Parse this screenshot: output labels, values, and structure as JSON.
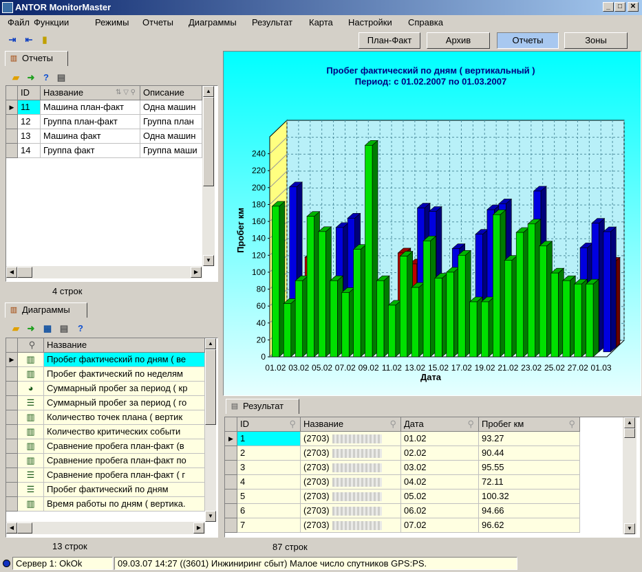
{
  "window": {
    "title": "ANTOR MonitorMaster"
  },
  "menu": [
    "Файл",
    "Функции",
    "Режимы",
    "Отчеты",
    "Диаграммы",
    "Результат",
    "Карта",
    "Настройки",
    "Справка"
  ],
  "top_buttons": [
    "План-Факт",
    "Архив",
    "Отчеты",
    "Зоны"
  ],
  "reports_panel": {
    "tab": "Отчеты",
    "columns": [
      "ID",
      "Название",
      "Описание"
    ],
    "rows": [
      {
        "id": "11",
        "name": "Машина план-факт",
        "desc": "Одна машин"
      },
      {
        "id": "12",
        "name": "Группа план-факт",
        "desc": "Группа план"
      },
      {
        "id": "13",
        "name": "Машина факт",
        "desc": "Одна машин"
      },
      {
        "id": "14",
        "name": "Группа факт",
        "desc": "Группа маши"
      }
    ],
    "count": "4 строк"
  },
  "diagrams_panel": {
    "tab": "Диаграммы",
    "column": "Название",
    "rows": [
      "Пробег фактический по дням ( ве",
      "Пробег фактический по неделям",
      "Суммарный пробег за период ( кр",
      "Суммарный пробег за период ( го",
      "Количество точек плана ( вертик",
      "Количество критических событи",
      "Сравнение пробега план-факт (в",
      "Сравнение пробега план-факт по",
      "Сравнение пробега план-факт ( г",
      "Пробег фактический по дням",
      "Время работы по дням ( вертика."
    ],
    "count": "13 строк"
  },
  "chart_data": {
    "type": "bar",
    "title": "Пробег фактический по дням ( вертикальный )",
    "subtitle": "Период: с 01.02.2007 по 01.03.2007",
    "xlabel": "Дата",
    "ylabel": "Пробег км",
    "ylim": [
      0,
      260
    ],
    "yticks": [
      0,
      20,
      40,
      60,
      80,
      100,
      120,
      140,
      160,
      180,
      200,
      220,
      240
    ],
    "tick_labels": [
      "01.02",
      "03.02",
      "05.02",
      "07.02",
      "09.02",
      "11.02",
      "13.02",
      "15.02",
      "17.02",
      "19.02",
      "21.02",
      "23.02",
      "25.02",
      "27.02",
      "01.03"
    ],
    "grid": true,
    "series": [
      {
        "color": "#00e000",
        "values": [
          178,
          63,
          90,
          166,
          148,
          90,
          76,
          127,
          250,
          90,
          61,
          119,
          82,
          137,
          93,
          100,
          120,
          65,
          65,
          168,
          114,
          147,
          157,
          131,
          99,
          90,
          86,
          86,
          0
        ]
      },
      {
        "color": "#0000e0",
        "values": [
          0,
          195,
          0,
          0,
          0,
          147,
          158,
          0,
          0,
          0,
          0,
          0,
          170,
          166,
          0,
          122,
          0,
          139,
          168,
          175,
          0,
          0,
          190,
          0,
          0,
          0,
          123,
          152,
          142
        ]
      },
      {
        "color": "#c00000",
        "values": [
          0,
          0,
          108,
          0,
          0,
          0,
          0,
          0,
          0,
          0,
          113,
          100,
          0,
          0,
          0,
          0,
          0,
          0,
          0,
          0,
          0,
          0,
          0,
          0,
          0,
          0,
          0,
          0,
          102
        ]
      }
    ]
  },
  "result_panel": {
    "tab": "Результат",
    "columns": [
      "ID",
      "Название",
      "Дата",
      "Пробег км"
    ],
    "rows": [
      {
        "id": "1",
        "name": "(2703)",
        "date": "01.02",
        "km": "93.27"
      },
      {
        "id": "2",
        "name": "(2703)",
        "date": "02.02",
        "km": "90.44"
      },
      {
        "id": "3",
        "name": "(2703)",
        "date": "03.02",
        "km": "95.55"
      },
      {
        "id": "4",
        "name": "(2703)",
        "date": "04.02",
        "km": "72.11"
      },
      {
        "id": "5",
        "name": "(2703)",
        "date": "05.02",
        "km": "100.32"
      },
      {
        "id": "6",
        "name": "(2703)",
        "date": "06.02",
        "km": "94.66"
      },
      {
        "id": "7",
        "name": "(2703)",
        "date": "07.02",
        "km": "96.62"
      }
    ],
    "count": "87 строк"
  },
  "status": {
    "server": "Сервер 1: OkOk",
    "message": "09.03.07 14:27 ((3601) Инжиниринг сбыт) Малое число спутников GPS:PS."
  }
}
